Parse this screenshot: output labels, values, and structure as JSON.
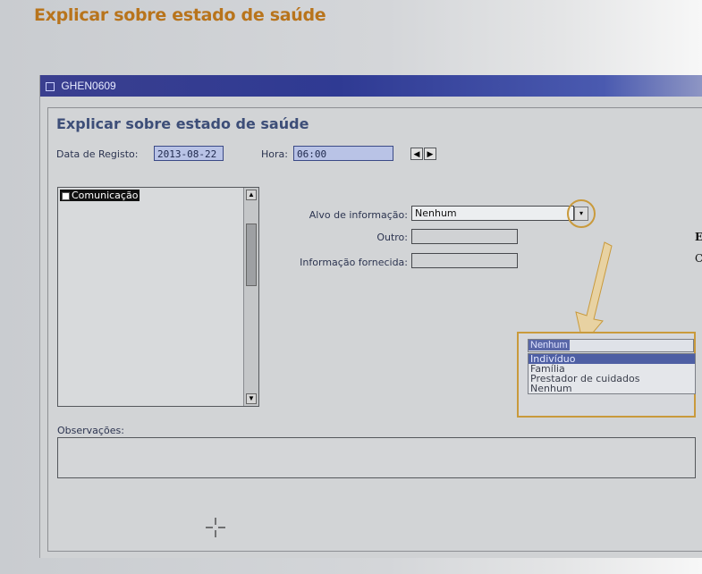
{
  "slide": {
    "title": "Explicar sobre estado de saúde"
  },
  "window": {
    "title": "GHEN0609",
    "form_title": "Explicar sobre estado de saúde",
    "data_registo_label": "Data de Registo:",
    "data_registo_value": "2013-08-22",
    "hora_label": "Hora:",
    "hora_value": "06:00",
    "tree_item": "Comunicação",
    "alvo_label": "Alvo de informação:",
    "alvo_value": "Nenhum",
    "outro_label": "Outro:",
    "outro_value": "",
    "informacao_label": "Informação fornecida:",
    "informacao_value": "",
    "observacoes_label": "Observações:"
  },
  "dropdown": {
    "selected": "Nenhum",
    "options": [
      "Indivíduo",
      "Família",
      "Prestador de cuidados",
      "Nenhum"
    ],
    "highlighted_index": 0
  },
  "side_text": {
    "line1": "E",
    "line2": "C"
  },
  "colors": {
    "accent": "#c99a3c",
    "titlebar": "#2f3a93",
    "field_fill": "#b9c3e6"
  },
  "icons": [
    "previous-arrow-icon",
    "next-arrow-icon",
    "dropdown-arrow-icon",
    "scroll-up-icon",
    "scroll-down-icon",
    "crosshair-icon"
  ]
}
